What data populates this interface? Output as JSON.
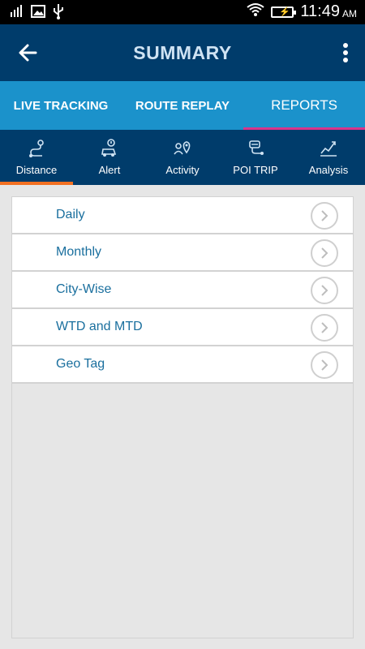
{
  "status_bar": {
    "time": "11:49",
    "ampm": "AM"
  },
  "app_bar": {
    "title": "SUMMARY"
  },
  "top_tabs": [
    {
      "label": "LIVE TRACKING",
      "active": false
    },
    {
      "label": "ROUTE REPLAY",
      "active": false
    },
    {
      "label": "REPORTS",
      "active": true
    }
  ],
  "sub_tabs": [
    {
      "label": "Distance",
      "icon": "route-icon",
      "active": true
    },
    {
      "label": "Alert",
      "icon": "car-alert-icon",
      "active": false
    },
    {
      "label": "Activity",
      "icon": "users-location-icon",
      "active": false
    },
    {
      "label": "POI TRIP",
      "icon": "poi-trip-icon",
      "active": false
    },
    {
      "label": "Analysis",
      "icon": "chart-line-icon",
      "active": false
    }
  ],
  "reports": [
    {
      "label": "Daily"
    },
    {
      "label": "Monthly"
    },
    {
      "label": "City-Wise"
    },
    {
      "label": "WTD and MTD"
    },
    {
      "label": "Geo Tag"
    }
  ],
  "colors": {
    "app_bar": "#003c6b",
    "tabs": "#1b92cb",
    "active_indicator_top": "#d9348b",
    "active_indicator_sub": "#f27022",
    "list_text": "#1a6f9e"
  }
}
